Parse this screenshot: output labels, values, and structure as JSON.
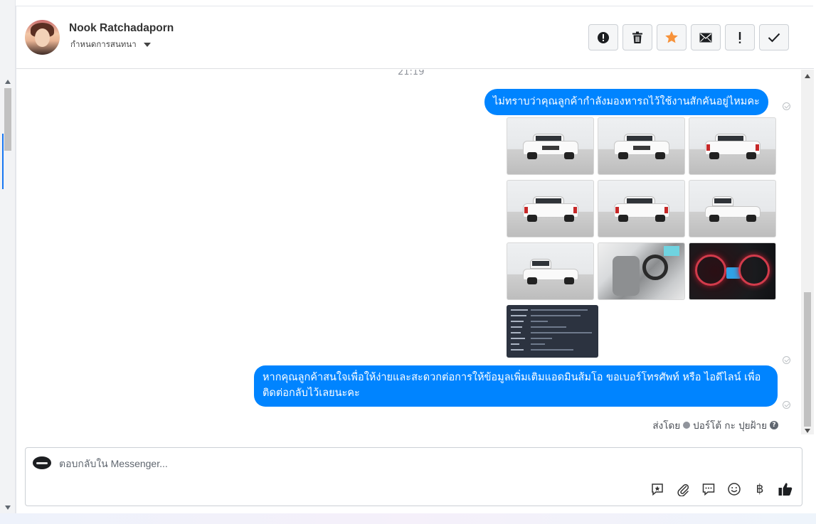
{
  "contact": {
    "name": "Nook Ratchadaporn",
    "assign_label": "กำหนดการสนทนา"
  },
  "toolbar": [
    {
      "icon": "spam-icon"
    },
    {
      "icon": "trash-icon"
    },
    {
      "icon": "star-icon"
    },
    {
      "icon": "mail-icon"
    },
    {
      "icon": "important-icon"
    },
    {
      "icon": "check-icon"
    }
  ],
  "conversation": {
    "timestamp": "21:19",
    "message_1": "ไม่ทราบว่าคุณลูกค้ากำลังมองหารถไว้ใช้งานสักคันอยู่ไหมคะ",
    "message_2": "หากคุณลูกค้าสนใจเพื่อให้ง่ายและสะดวกต่อการให้ข้อมูลเพิ่มเติมแอดมินส้มโอ ขอเบอร์โทรศัพท์ หรือ ไอดีไลน์ เพื่อติดต่อกลับไว้เลยนะคะ",
    "sent_by_label": "ส่งโดย",
    "sent_by_name": "ปอร์โต้ กะ ปุยฝ้าย",
    "help_mark": "?"
  },
  "composer": {
    "placeholder": "ตอบกลับใน Messenger...",
    "currency_symbol": "฿"
  },
  "colors": {
    "bubble": "#0084ff",
    "star": "#f7923a"
  }
}
